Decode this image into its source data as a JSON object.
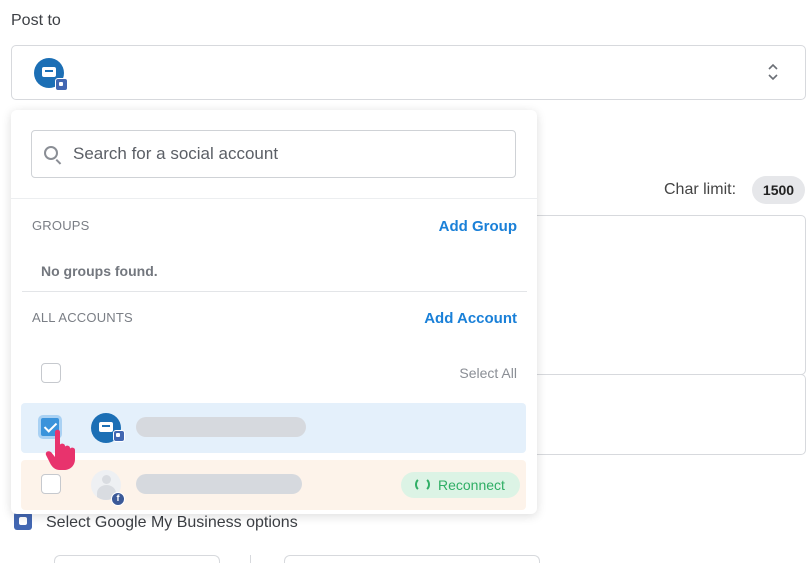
{
  "post_to": {
    "label": "Post to"
  },
  "search": {
    "placeholder": "Search for a social account"
  },
  "groups": {
    "header": "GROUPS",
    "add_link": "Add Group",
    "empty_text": "No groups found."
  },
  "accounts": {
    "header": "ALL ACCOUNTS",
    "add_link": "Add Account",
    "select_all_label": "Select All",
    "items": [
      {
        "checked": true,
        "network": "google-my-business"
      },
      {
        "checked": false,
        "network": "facebook",
        "action_label": "Reconnect"
      }
    ]
  },
  "editor": {
    "char_limit_label": "Char limit:",
    "char_limit_value": "1500"
  },
  "gmb_options": {
    "label": "Select Google My Business options"
  },
  "colors": {
    "accent_link": "#1a80d8",
    "selected_row": "#e4f0fb",
    "warning_row": "#fdf3ea",
    "reconnect_green": "#2fae65",
    "pointer_pink": "#e8336d"
  }
}
